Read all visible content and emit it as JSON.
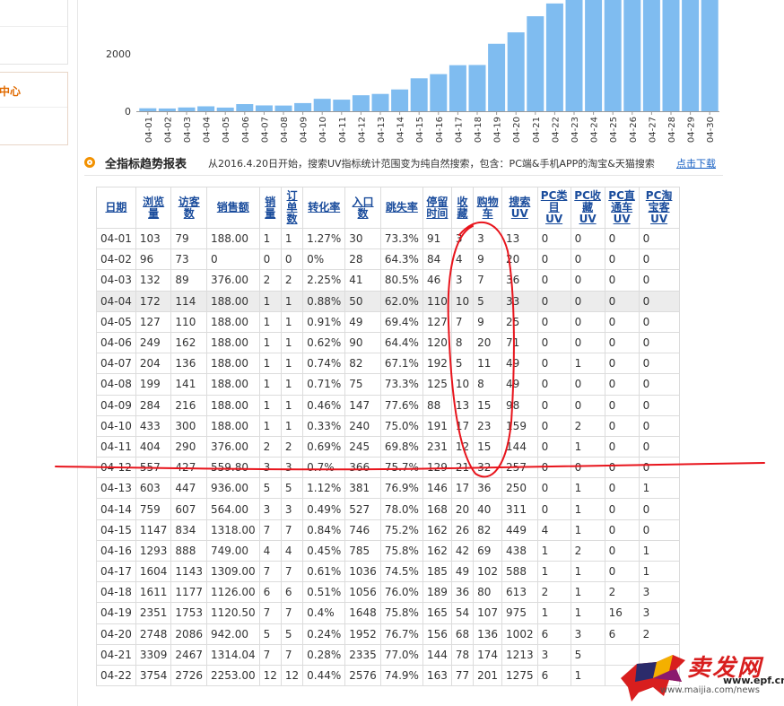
{
  "sidebar": {
    "center_label": "中心"
  },
  "chart_data": {
    "type": "bar",
    "color": "#7fbcf0",
    "categories": [
      "04-01",
      "04-02",
      "04-03",
      "04-04",
      "04-05",
      "04-06",
      "04-07",
      "04-08",
      "04-09",
      "04-10",
      "04-11",
      "04-12",
      "04-13",
      "04-14",
      "04-15",
      "04-16",
      "04-17",
      "04-18",
      "04-19",
      "04-20",
      "04-21",
      "04-22",
      "04-23",
      "04-24",
      "04-25",
      "04-26",
      "04-27",
      "04-28",
      "04-29",
      "04-30"
    ],
    "values": [
      103,
      96,
      132,
      172,
      127,
      249,
      204,
      199,
      284,
      433,
      404,
      557,
      603,
      759,
      1147,
      1293,
      1604,
      1611,
      2351,
      2748,
      3309,
      3754,
      4000,
      4000,
      4000,
      4000,
      4000,
      4000,
      4000,
      4000
    ],
    "yticks": [
      "0",
      "2000"
    ],
    "ylim": [
      0,
      4500
    ]
  },
  "section": {
    "title": "全指标趋势报表",
    "note": "从2016.4.20日开始，搜索UV指标统计范围变为纯自然搜索，包含：PC端&手机APP的淘宝&天猫搜索",
    "download_link": "点击下载"
  },
  "table": {
    "headers": [
      "日期",
      "浏览量",
      "访客数",
      "销售额",
      "销量",
      "订单数",
      "转化率",
      "入口数",
      "跳失率",
      "停留时间",
      "收藏",
      "购物车",
      "搜索UV",
      "PC类目UV",
      "PC收藏UV",
      "PC直通车UV",
      "PC淘宝客UV"
    ],
    "rows": [
      [
        "04-01",
        "103",
        "79",
        "188.00",
        "1",
        "1",
        "1.27%",
        "30",
        "73.3%",
        "91",
        "3",
        "3",
        "13",
        "0",
        "0",
        "0",
        "0"
      ],
      [
        "04-02",
        "96",
        "73",
        "0",
        "0",
        "0",
        "0%",
        "28",
        "64.3%",
        "84",
        "4",
        "9",
        "20",
        "0",
        "0",
        "0",
        "0"
      ],
      [
        "04-03",
        "132",
        "89",
        "376.00",
        "2",
        "2",
        "2.25%",
        "41",
        "80.5%",
        "46",
        "3",
        "7",
        "36",
        "0",
        "0",
        "0",
        "0"
      ],
      [
        "04-04",
        "172",
        "114",
        "188.00",
        "1",
        "1",
        "0.88%",
        "50",
        "62.0%",
        "110",
        "10",
        "5",
        "33",
        "0",
        "0",
        "0",
        "0"
      ],
      [
        "04-05",
        "127",
        "110",
        "188.00",
        "1",
        "1",
        "0.91%",
        "49",
        "69.4%",
        "127",
        "7",
        "9",
        "25",
        "0",
        "0",
        "0",
        "0"
      ],
      [
        "04-06",
        "249",
        "162",
        "188.00",
        "1",
        "1",
        "0.62%",
        "90",
        "64.4%",
        "120",
        "8",
        "20",
        "71",
        "0",
        "0",
        "0",
        "0"
      ],
      [
        "04-07",
        "204",
        "136",
        "188.00",
        "1",
        "1",
        "0.74%",
        "82",
        "67.1%",
        "192",
        "5",
        "11",
        "49",
        "0",
        "1",
        "0",
        "0"
      ],
      [
        "04-08",
        "199",
        "141",
        "188.00",
        "1",
        "1",
        "0.71%",
        "75",
        "73.3%",
        "125",
        "10",
        "8",
        "49",
        "0",
        "0",
        "0",
        "0"
      ],
      [
        "04-09",
        "284",
        "216",
        "188.00",
        "1",
        "1",
        "0.46%",
        "147",
        "77.6%",
        "88",
        "13",
        "15",
        "98",
        "0",
        "0",
        "0",
        "0"
      ],
      [
        "04-10",
        "433",
        "300",
        "188.00",
        "1",
        "1",
        "0.33%",
        "240",
        "75.0%",
        "191",
        "17",
        "23",
        "159",
        "0",
        "2",
        "0",
        "0"
      ],
      [
        "04-11",
        "404",
        "290",
        "376.00",
        "2",
        "2",
        "0.69%",
        "245",
        "69.8%",
        "231",
        "12",
        "15",
        "144",
        "0",
        "1",
        "0",
        "0"
      ],
      [
        "04-12",
        "557",
        "427",
        "559.80",
        "3",
        "3",
        "0.7%",
        "366",
        "75.7%",
        "129",
        "21",
        "32",
        "257",
        "0",
        "0",
        "0",
        "0"
      ],
      [
        "04-13",
        "603",
        "447",
        "936.00",
        "5",
        "5",
        "1.12%",
        "381",
        "76.9%",
        "146",
        "17",
        "36",
        "250",
        "0",
        "1",
        "0",
        "1"
      ],
      [
        "04-14",
        "759",
        "607",
        "564.00",
        "3",
        "3",
        "0.49%",
        "527",
        "78.0%",
        "168",
        "20",
        "40",
        "311",
        "0",
        "1",
        "0",
        "0"
      ],
      [
        "04-15",
        "1147",
        "834",
        "1318.00",
        "7",
        "7",
        "0.84%",
        "746",
        "75.2%",
        "162",
        "26",
        "82",
        "449",
        "4",
        "1",
        "0",
        "0"
      ],
      [
        "04-16",
        "1293",
        "888",
        "749.00",
        "4",
        "4",
        "0.45%",
        "785",
        "75.8%",
        "162",
        "42",
        "69",
        "438",
        "1",
        "2",
        "0",
        "1"
      ],
      [
        "04-17",
        "1604",
        "1143",
        "1309.00",
        "7",
        "7",
        "0.61%",
        "1036",
        "74.5%",
        "185",
        "49",
        "102",
        "588",
        "1",
        "1",
        "0",
        "1"
      ],
      [
        "04-18",
        "1611",
        "1177",
        "1126.00",
        "6",
        "6",
        "0.51%",
        "1056",
        "76.0%",
        "189",
        "36",
        "80",
        "613",
        "2",
        "1",
        "2",
        "3"
      ],
      [
        "04-19",
        "2351",
        "1753",
        "1120.50",
        "7",
        "7",
        "0.4%",
        "1648",
        "75.8%",
        "165",
        "54",
        "107",
        "975",
        "1",
        "1",
        "16",
        "3"
      ],
      [
        "04-20",
        "2748",
        "2086",
        "942.00",
        "5",
        "5",
        "0.24%",
        "1952",
        "76.7%",
        "156",
        "68",
        "136",
        "1002",
        "6",
        "3",
        "6",
        "2"
      ],
      [
        "04-21",
        "3309",
        "2467",
        "1314.04",
        "7",
        "7",
        "0.28%",
        "2335",
        "77.0%",
        "144",
        "78",
        "174",
        "1213",
        "3",
        "5",
        "",
        ""
      ],
      [
        "04-22",
        "3754",
        "2726",
        "2253.00",
        "12",
        "12",
        "0.44%",
        "2576",
        "74.9%",
        "163",
        "77",
        "201",
        "1275",
        "6",
        "1",
        "",
        ""
      ]
    ],
    "highlight_row": "04-04"
  },
  "watermark": {
    "brand": "卖发网",
    "site": "www.epf.cn",
    "url": "www.maijia.com/news"
  },
  "annotation_color": "#e8141c"
}
